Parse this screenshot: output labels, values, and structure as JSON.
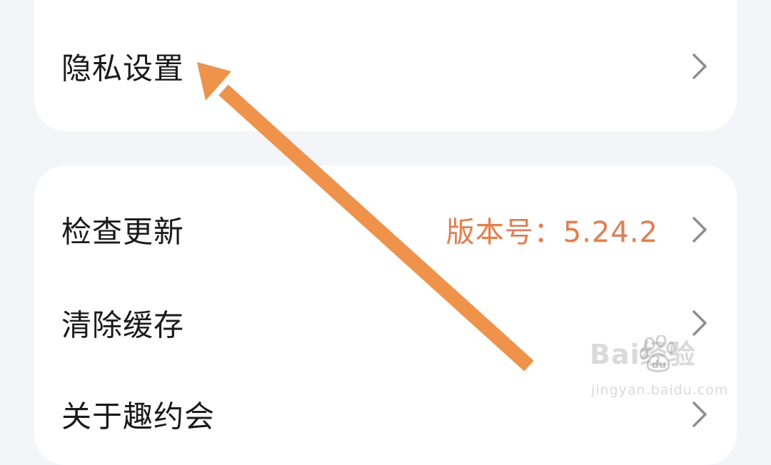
{
  "settings": {
    "items": [
      {
        "label": "隐私设置",
        "value": ""
      },
      {
        "label": "检查更新",
        "value": "版本号：5.24.2"
      },
      {
        "label": "清除缓存",
        "value": ""
      },
      {
        "label": "关于趣约会",
        "value": ""
      }
    ]
  },
  "colors": {
    "background": "#f4f5f9",
    "card": "#ffffff",
    "version_text": "#ec7b4c",
    "annotation_arrow": "#f0934a",
    "chevron": "#8e8e8e"
  },
  "watermark": {
    "logo_text": "Bai经验",
    "logo_sub": "du",
    "url": "jingyan.baidu.com"
  }
}
